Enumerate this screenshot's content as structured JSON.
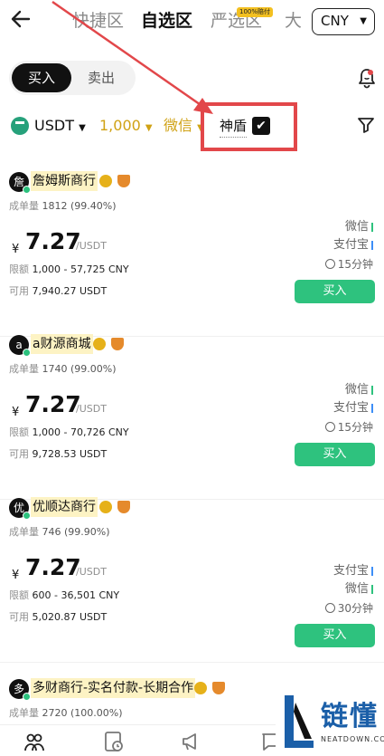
{
  "topnav": {
    "tabs": [
      "快捷区",
      "自选区",
      "严选区",
      "大"
    ],
    "active_tab": "自选区",
    "badge": "100%赔付",
    "currency": "CNY"
  },
  "toggle": {
    "buy": "买入",
    "sell": "卖出"
  },
  "filters": {
    "coin": "USDT",
    "amount": "1,000",
    "payment": "微信",
    "shield_label": "神盾",
    "shield_checked": true
  },
  "cards": [
    {
      "avatar": "詹",
      "name": "詹姆斯商行",
      "orders_label": "成单量",
      "orders": "1812 (99.40%)",
      "currency": "¥",
      "price": "7.27",
      "unit": "/USDT",
      "limit_label": "限额",
      "limit": "1,000 - 57,725 CNY",
      "avail_label": "可用",
      "avail": "7,940.27 USDT",
      "payments": [
        "微信",
        "支付宝"
      ],
      "time": "15分钟",
      "button": "买入"
    },
    {
      "avatar": "a",
      "name": "a财源商城",
      "orders_label": "成单量",
      "orders": "1740 (99.00%)",
      "currency": "¥",
      "price": "7.27",
      "unit": "/USDT",
      "limit_label": "限额",
      "limit": "1,000 - 70,726 CNY",
      "avail_label": "可用",
      "avail": "9,728.53 USDT",
      "payments": [
        "微信",
        "支付宝"
      ],
      "time": "15分钟",
      "button": "买入"
    },
    {
      "avatar": "优",
      "name": "优顺达商行",
      "orders_label": "成单量",
      "orders": "746 (99.90%)",
      "currency": "¥",
      "price": "7.27",
      "unit": "/USDT",
      "limit_label": "限额",
      "limit": "600 - 36,501 CNY",
      "avail_label": "可用",
      "avail": "5,020.87 USDT",
      "payments": [
        "支付宝",
        "微信"
      ],
      "time": "30分钟",
      "button": "买入"
    },
    {
      "avatar": "多",
      "name": "多财商行-实名付款-长期合作",
      "orders_label": "成单量",
      "orders": "2720 (100.00%)"
    }
  ],
  "colors": {
    "buy_green": "#2ec27e",
    "accent_gold": "#d0a215",
    "highlight_red": "#e2474a",
    "wechat_green": "#2ec27e",
    "alipay_blue": "#3d8ef7"
  },
  "watermark": {
    "text": "链懂",
    "sub": "NEATDOWN.COM"
  }
}
